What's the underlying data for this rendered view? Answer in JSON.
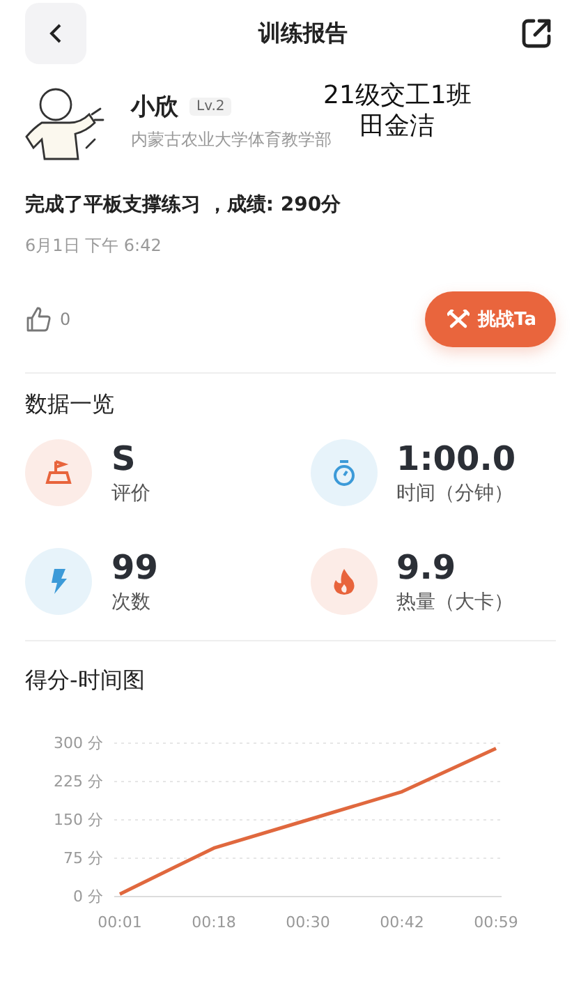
{
  "header": {
    "title": "训练报告"
  },
  "profile": {
    "name": "小欣",
    "level": "Lv.2",
    "org": "内蒙古农业大学体育教学部",
    "note_lines": [
      "21级交工1班",
      "田金洁"
    ]
  },
  "summary": {
    "text": "完成了平板支撑练习 ，成绩: 290分",
    "date": "6月1日 下午 6:42"
  },
  "likes": {
    "count": "0"
  },
  "challenge_button": {
    "label": "挑战Ta"
  },
  "overview": {
    "title": "数据一览",
    "stats": [
      {
        "kind": "grade",
        "color": "#e8643c",
        "value": "S",
        "label": "评价"
      },
      {
        "kind": "timer",
        "color": "#3c9ad8",
        "value": "1:00.0",
        "label": "时间（分钟）"
      },
      {
        "kind": "bolt",
        "color": "#3c9ad8",
        "value": "99",
        "label": "次数"
      },
      {
        "kind": "flame",
        "color": "#e8643c",
        "value": "9.9",
        "label": "热量（大卡）"
      }
    ]
  },
  "chart_section": {
    "title": "得分-时间图",
    "chart_data": {
      "type": "line",
      "grid": true,
      "categories": [
        "00:01",
        "00:18",
        "00:30",
        "00:42",
        "00:59"
      ],
      "series": [
        {
          "color": "#e0683e",
          "values": [
            5,
            95,
            150,
            205,
            290
          ]
        }
      ],
      "ylim": [
        0,
        300
      ],
      "yticks": [
        {
          "value": 0,
          "label": "0 分"
        },
        {
          "value": 75,
          "label": "75 分"
        },
        {
          "value": 150,
          "label": "150 分"
        },
        {
          "value": 225,
          "label": "225 分"
        },
        {
          "value": 300,
          "label": "300 分"
        }
      ]
    }
  }
}
